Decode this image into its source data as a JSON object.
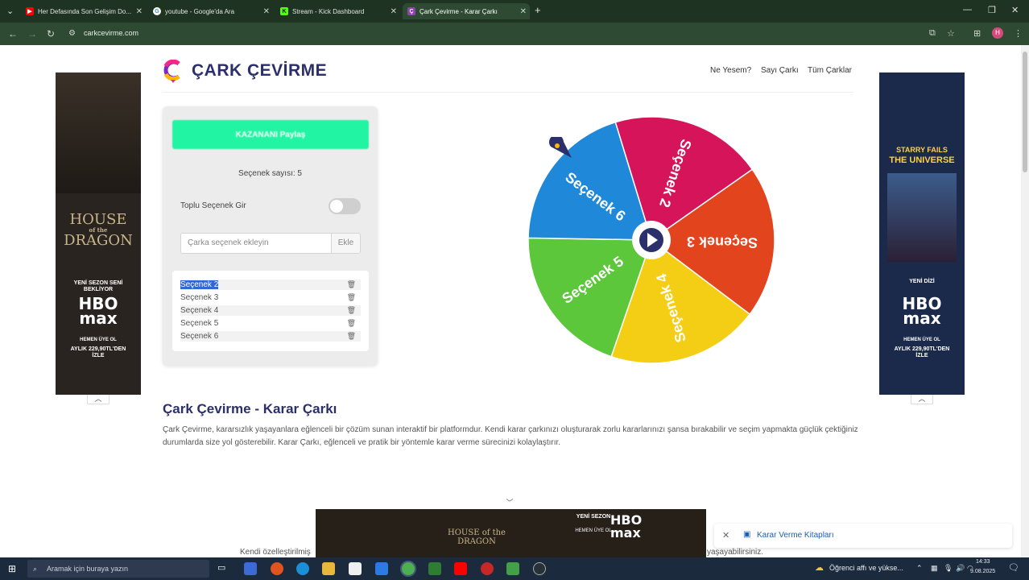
{
  "browser": {
    "tabs": [
      {
        "title": "Her Defasında Son Gelişim Do...",
        "favicon": "youtube-icon",
        "color": "#ff0000"
      },
      {
        "title": "youtube - Google'da Ara",
        "favicon": "google-icon",
        "color": "#ffffff"
      },
      {
        "title": "Stream - Kick Dashboard",
        "favicon": "kick-icon",
        "color": "#53fc18"
      },
      {
        "title": "Çark Çevirme - Karar Çarkı",
        "favicon": "cark-icon",
        "color": "#8e44ad"
      }
    ],
    "url": "carkcevirme.com",
    "profile_initial": "H"
  },
  "site": {
    "logo_text": "ÇARK ÇEVİRME",
    "nav": [
      "Ne Yesem?",
      "Sayı Çarkı",
      "Tüm Çarklar"
    ]
  },
  "panel": {
    "winner_button": "KAZANANI Paylaş",
    "option_count": "Seçenek sayısı: 5",
    "bulk_label": "Toplu Seçenek Gir",
    "bulk_enabled": false,
    "add_placeholder": "Çarka seçenek ekleyin",
    "add_button": "Ekle",
    "options": [
      "Seçenek 2",
      "Seçenek 3",
      "Seçenek 4",
      "Seçenek 5",
      "Seçenek 6"
    ],
    "selected_option": "Seçenek 2"
  },
  "wheel": {
    "segments": [
      {
        "label": "Seçenek 2",
        "color": "#d6145a"
      },
      {
        "label": "Seçenek 3",
        "color": "#e2451e"
      },
      {
        "label": "Seçenek 4",
        "color": "#f4ce14"
      },
      {
        "label": "Seçenek 5",
        "color": "#5cc73a"
      },
      {
        "label": "Seçenek 6",
        "color": "#1f88d8"
      }
    ],
    "play_icon": "play-icon"
  },
  "content": {
    "heading": "Çark Çevirme - Karar Çarkı",
    "paragraph": "Çark Çevirme, kararsızlık yaşayanlara eğlenceli bir çözüm sunan interaktif bir platformdur. Kendi karar çarkınızı oluşturarak zorlu kararlarınızı şansa bırakabilir ve seçim yapmakta güçlük çektiğiniz durumlarda size yol gösterebilir. Karar Çarkı, eğlenceli ve pratik bir yöntemle karar verme sürecinizi kolaylaştırır.",
    "para2_start": "Kendi özelleştirilmiş",
    "para2_end": "yaşayabilirsiniz."
  },
  "ads": {
    "left": {
      "house": "HOUSE",
      "of": "of the",
      "dragon": "DRAGON",
      "tag": "YENİ SEZON SENİ BEKLİYOR",
      "brand": "HBO max",
      "cta": "HEMEN ÜYE OL",
      "price": "AYLIK 229,90TL'DEN İZLE"
    },
    "right": {
      "title1": "STARRY FAILS",
      "title2": "THE UNIVERSE",
      "tag": "YENİ DİZİ",
      "brand": "HBO max",
      "cta": "HEMEN ÜYE OL",
      "price": "AYLIK 229,90TL'DEN İZLE"
    },
    "bottom": {
      "title": "HOUSE of the DRAGON",
      "brand": "HBO max",
      "tag": "YENİ SEZON",
      "cta": "HEMEN ÜYE OL"
    }
  },
  "books_bar": {
    "label": "Karar Verme Kitapları"
  },
  "taskbar": {
    "search_placeholder": "Aramak için buraya yazın",
    "notification": "Öğrenci affı ve yükse...",
    "time": "14:33",
    "date": "9.08.2025"
  }
}
